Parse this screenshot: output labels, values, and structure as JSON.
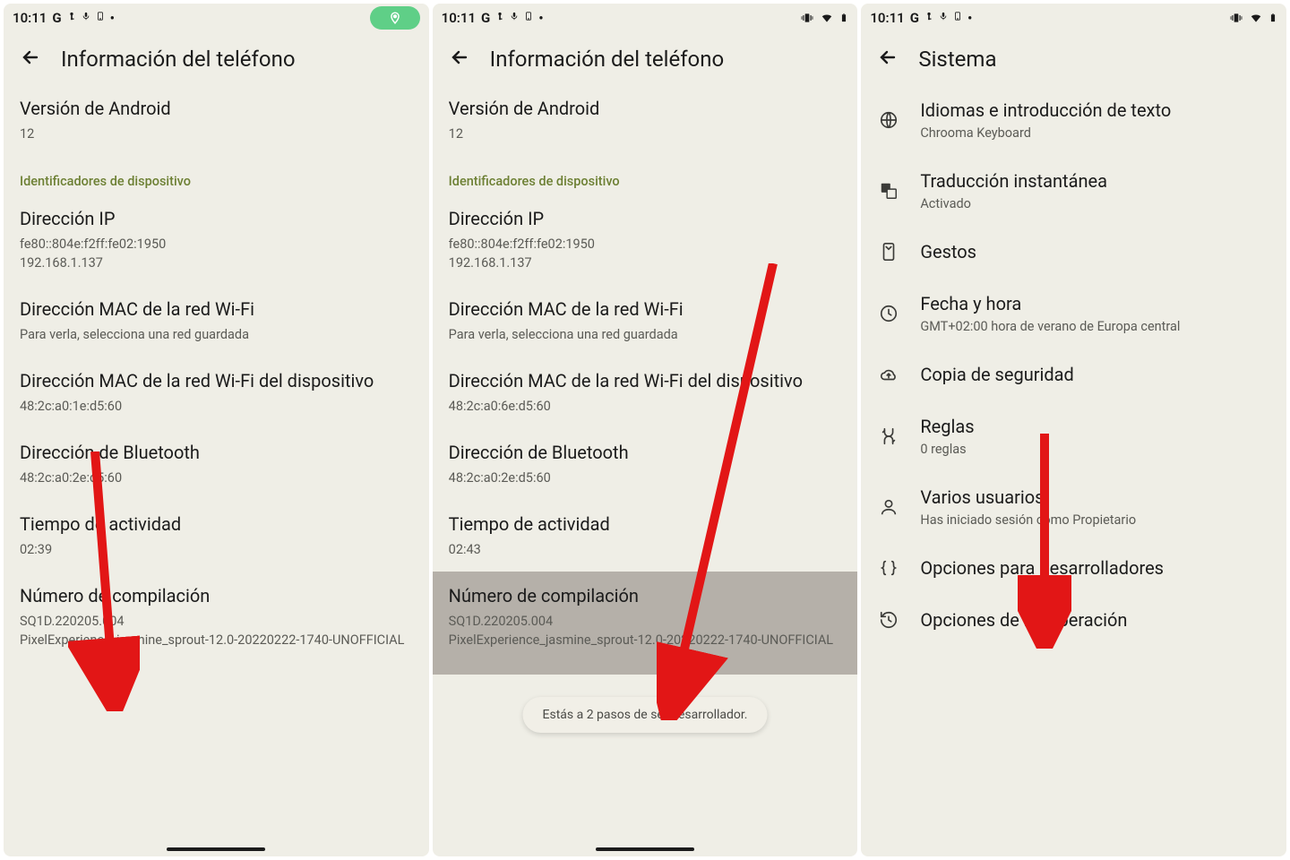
{
  "status": {
    "time": "10:11",
    "letter": "G",
    "dot": "•"
  },
  "p1": {
    "header": "Información del teléfono",
    "androidVersion": {
      "title": "Versión de Android",
      "value": "12"
    },
    "sectionHeader": "Identificadores de dispositivo",
    "ip": {
      "title": "Dirección IP",
      "line1": "fe80::804e:f2ff:fe02:1950",
      "line2": "192.168.1.137"
    },
    "wifiMac": {
      "title": "Dirección MAC de la red Wi-Fi",
      "sub": "Para verla, selecciona una red guardada"
    },
    "deviceWifiMac": {
      "title": "Dirección MAC de la red Wi-Fi del dispositivo",
      "value": "48:2c:a0:1e:d5:60"
    },
    "bt": {
      "title": "Dirección de Bluetooth",
      "value": "48:2c:a0:2e:d5:60"
    },
    "uptime": {
      "title": "Tiempo de actividad",
      "value": "02:39"
    },
    "build": {
      "title": "Número de compilación",
      "line1": "SQ1D.220205.004",
      "line2": "PixelExperience_jasmine_sprout-12.0-20220222-1740-UNOFFICIAL"
    }
  },
  "p2": {
    "header": "Información del teléfono",
    "androidVersion": {
      "title": "Versión de Android",
      "value": "12"
    },
    "sectionHeader": "Identificadores de dispositivo",
    "ip": {
      "title": "Dirección IP",
      "line1": "fe80::804e:f2ff:fe02:1950",
      "line2": "192.168.1.137"
    },
    "wifiMac": {
      "title": "Dirección MAC de la red Wi-Fi",
      "sub": "Para verla, selecciona una red guardada"
    },
    "deviceWifiMac": {
      "title": "Dirección MAC de la red Wi-Fi del dispositivo",
      "value": "48:2c:a0:6e:d5:60"
    },
    "bt": {
      "title": "Dirección de Bluetooth",
      "value": "48:2c:a0:2e:d5:60"
    },
    "uptime": {
      "title": "Tiempo de actividad",
      "value": "02:43"
    },
    "build": {
      "title": "Número de compilación",
      "line1": "SQ1D.220205.004",
      "line2": "PixelExperience_jasmine_sprout-12.0-20220222-1740-UNOFFICIAL"
    },
    "toast": "Estás a 2 pasos de ser desarrollador."
  },
  "p3": {
    "header": "Sistema",
    "items": [
      {
        "title": "Idiomas e introducción de texto",
        "sub": "Chrooma Keyboard"
      },
      {
        "title": "Traducción instantánea",
        "sub": "Activado"
      },
      {
        "title": "Gestos",
        "sub": ""
      },
      {
        "title": "Fecha y hora",
        "sub": "GMT+02:00 hora de verano de Europa central"
      },
      {
        "title": "Copia de seguridad",
        "sub": ""
      },
      {
        "title": "Reglas",
        "sub": "0 reglas"
      },
      {
        "title": "Varios usuarios",
        "sub": "Has iniciado sesión como Propietario"
      },
      {
        "title": "Opciones para desarrolladores",
        "sub": ""
      },
      {
        "title": "Opciones de recuperación",
        "sub": ""
      }
    ]
  }
}
